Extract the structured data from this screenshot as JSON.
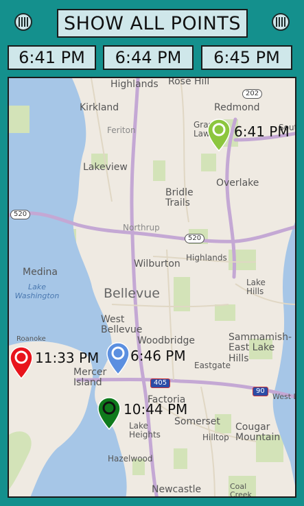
{
  "toolbar": {
    "show_all_label": "SHOW ALL POINTS",
    "left_icon": "menu-bars-icon",
    "right_icon": "menu-bars-icon"
  },
  "time_buttons": [
    "6:41 PM",
    "6:44 PM",
    "6:45 PM"
  ],
  "map": {
    "place_labels": {
      "highlands": "Highlands",
      "rose_hill": "Rose Hill",
      "kirkland": "Kirkland",
      "redmond": "Redmond",
      "grass_lawn": "Grass Lawn",
      "feriton": "Feriton",
      "south_redmond": "South",
      "lakeview": "Lakeview",
      "overlake": "Overlake",
      "bridle_trails": "Bridle Trails",
      "northrup": "Northrup",
      "medina": "Medina",
      "wilburton": "Wilburton",
      "highlands2": "Highlands",
      "bellevue": "Bellevue",
      "lake_hills": "Lake Hills",
      "west_bellevue": "West Bellevue",
      "woodbridge": "Woodbridge",
      "sammamish": "Sammamish-East Lake Hills",
      "roanoke": "Roanoke",
      "mercer_island": "Mercer Island",
      "factoria": "Factoria",
      "eastgate": "Eastgate",
      "west_lake": "West L",
      "somerset": "Somerset",
      "lake_heights": "Lake Heights",
      "hilltop": "Hilltop",
      "cougar_mountain": "Cougar Mountain",
      "hazelwood": "Hazelwood",
      "newcastle": "Newcastle",
      "coal_creek": "Coal Creek"
    },
    "water_labels": {
      "lake_washington": "Lake Washington"
    },
    "shields": {
      "sr202": "202",
      "sr520_west": "520",
      "sr520_east": "520",
      "i405": "405",
      "i90": "90"
    },
    "pins": [
      {
        "color": "#8cc63e",
        "time": "6:41 PM"
      },
      {
        "color": "#e8141c",
        "time": "11:33 PM"
      },
      {
        "color": "#5b8fe0",
        "time": "6:46 PM"
      },
      {
        "color": "#0f7a1c",
        "time": "10:44 PM"
      }
    ]
  }
}
